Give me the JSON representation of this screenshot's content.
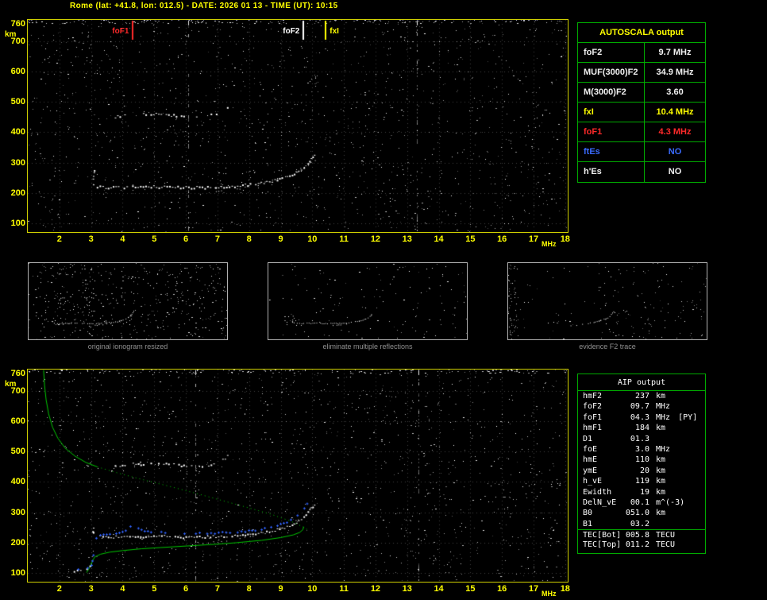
{
  "header": {
    "title": "Rome (lat: +41.8, lon: 012.5) - DATE: 2026 01 13 - TIME (UT): 10:15"
  },
  "autoscala": {
    "title": "AUTOSCALA output",
    "rows": [
      {
        "label": "foF2",
        "value": "9.7 MHz",
        "color": "#f0f0f0"
      },
      {
        "label": "MUF(3000)F2",
        "value": "34.9 MHz",
        "color": "#f0f0f0"
      },
      {
        "label": "M(3000)F2",
        "value": "3.60",
        "color": "#f0f0f0"
      },
      {
        "label": "fxI",
        "value": "10.4 MHz",
        "color": "#ffff00"
      },
      {
        "label": "foF1",
        "value": "4.3 MHz",
        "color": "#ff2a2a"
      },
      {
        "label": "ftEs",
        "value": "NO",
        "color": "#3a6bff"
      },
      {
        "label": "h'Es",
        "value": "NO",
        "color": "#f0f0f0"
      }
    ]
  },
  "aip": {
    "title": "AIP output",
    "rows": [
      {
        "label": "hmF2",
        "value": "237",
        "unit": "km",
        "extra": ""
      },
      {
        "label": "foF2",
        "value": "09.7",
        "unit": "MHz",
        "extra": ""
      },
      {
        "label": "foF1",
        "value": "04.3",
        "unit": "MHz",
        "extra": "[PY]"
      },
      {
        "label": "hmF1",
        "value": "184",
        "unit": "km",
        "extra": ""
      },
      {
        "label": "D1",
        "value": "01.3",
        "unit": "",
        "extra": ""
      },
      {
        "label": "foE",
        "value": "3.0",
        "unit": "MHz",
        "extra": ""
      },
      {
        "label": "hmE",
        "value": "110",
        "unit": "km",
        "extra": ""
      },
      {
        "label": "ymE",
        "value": "20",
        "unit": "km",
        "extra": ""
      },
      {
        "label": "h_vE",
        "value": "119",
        "unit": "km",
        "extra": ""
      },
      {
        "label": "Ewidth",
        "value": "19",
        "unit": "km",
        "extra": ""
      },
      {
        "label": "DelN_vE",
        "value": "00.1",
        "unit": "m^(-3)",
        "extra": ""
      },
      {
        "label": "B0",
        "value": "051.0",
        "unit": "km",
        "extra": ""
      },
      {
        "label": "B1",
        "value": "03.2",
        "unit": "",
        "extra": ""
      },
      {
        "label": "TEC[Bot]",
        "value": "005.8",
        "unit": "TECU",
        "extra": "",
        "sep": true
      },
      {
        "label": "TEC[Top]",
        "value": "011.2",
        "unit": "TECU",
        "extra": ""
      }
    ]
  },
  "thumbs": [
    {
      "caption": "original ionogram resized"
    },
    {
      "caption": "eliminate multiple reflections"
    },
    {
      "caption": "evidence F2 trace"
    }
  ],
  "chart_data": [
    {
      "id": "main_ionogram",
      "type": "scatter",
      "title": "vertical incidence ionogram",
      "xlabel": "MHz",
      "ylabel": "km",
      "xlim": [
        1,
        18.08
      ],
      "ylim": [
        70,
        772
      ],
      "xticks": [
        2,
        3,
        4,
        5,
        6,
        7,
        8,
        9,
        10,
        11,
        12,
        13,
        14,
        15,
        16,
        17,
        18
      ],
      "yticks": [
        760,
        700,
        600,
        500,
        400,
        300,
        200,
        100
      ],
      "grid": true,
      "markers": [
        {
          "label": "foF1",
          "x": 4.3,
          "color": "#ff2a2a",
          "side": "left"
        },
        {
          "label": "foF2",
          "x": 9.7,
          "color": "#ffffff",
          "side": "left"
        },
        {
          "label": "fxI",
          "x": 10.4,
          "color": "#ffff00",
          "side": "right"
        }
      ],
      "streaks": [
        6.08,
        13.3
      ],
      "noise": {
        "seed": 7,
        "count": 1400
      },
      "series": [
        {
          "name": "foE-spread",
          "style": "dots",
          "color": "#ffffff",
          "density": 0.55,
          "size": 2,
          "points": [
            [
              3.04,
              235
            ],
            [
              3.06,
              252
            ],
            [
              3.08,
              270
            ],
            [
              3.1,
              287
            ],
            [
              3.12,
              302
            ]
          ]
        },
        {
          "name": "f-trace-flat",
          "style": "dots",
          "color": "#ffffff",
          "density": 0.95,
          "size": 2,
          "points": [
            [
              3.06,
              231
            ],
            [
              3.18,
              223
            ],
            [
              3.45,
              219
            ],
            [
              3.85,
              219
            ],
            [
              4.3,
              221
            ],
            [
              4.8,
              222
            ],
            [
              5.3,
              221
            ],
            [
              5.9,
              219
            ],
            [
              6.5,
              219
            ],
            [
              7.1,
              221
            ],
            [
              7.7,
              225
            ],
            [
              8.1,
              229
            ],
            [
              8.45,
              234
            ]
          ]
        },
        {
          "name": "f-trace-rise",
          "style": "dots",
          "color": "#ffffff",
          "density": 0.92,
          "size": 2,
          "points": [
            [
              8.45,
              234
            ],
            [
              8.8,
              241
            ],
            [
              9.1,
              250
            ],
            [
              9.35,
              260
            ],
            [
              9.55,
              272
            ],
            [
              9.72,
              286
            ],
            [
              9.85,
              301
            ],
            [
              9.95,
              315
            ],
            [
              10.05,
              328
            ],
            [
              10.13,
              338
            ]
          ]
        },
        {
          "name": "x-trace",
          "style": "dots",
          "color": "#ffffff",
          "density": 0.5,
          "size": 1,
          "points": [
            [
              6.2,
              196
            ],
            [
              6.7,
              201
            ],
            [
              7.2,
              208
            ],
            [
              7.7,
              216
            ],
            [
              8.2,
              226
            ],
            [
              8.65,
              238
            ],
            [
              9.05,
              252
            ],
            [
              9.4,
              266
            ],
            [
              9.7,
              282
            ],
            [
              9.95,
              299
            ],
            [
              10.15,
              317
            ],
            [
              10.28,
              331
            ]
          ]
        },
        {
          "name": "second-hop",
          "style": "dots",
          "color": "#ffffff",
          "density": 0.45,
          "size": 2,
          "points": [
            [
              3.75,
              452
            ],
            [
              4.05,
              457
            ],
            [
              4.4,
              461
            ],
            [
              4.8,
              462
            ],
            [
              5.2,
              461
            ],
            [
              5.6,
              458
            ],
            [
              6.0,
              455
            ],
            [
              6.4,
              454
            ],
            [
              6.7,
              457
            ],
            [
              6.95,
              464
            ],
            [
              7.15,
              474
            ],
            [
              7.3,
              487
            ],
            [
              7.42,
              501
            ]
          ]
        }
      ]
    },
    {
      "id": "profile_ionogram",
      "type": "scatter",
      "title": "ionogram with restored trace and electron density profile",
      "xlabel": "MHz",
      "ylabel": "km",
      "xlim": [
        1,
        18.08
      ],
      "ylim": [
        70,
        772
      ],
      "xticks": [
        2,
        3,
        4,
        5,
        6,
        7,
        8,
        9,
        10,
        11,
        12,
        13,
        14,
        15,
        16,
        17,
        18
      ],
      "yticks": [
        760,
        700,
        600,
        500,
        400,
        300,
        200,
        100
      ],
      "grid": true,
      "markers": [],
      "streaks": [
        6.3,
        13.35
      ],
      "noise": {
        "seed": 13,
        "count": 1400
      },
      "series_from": "main_ionogram",
      "series_names": [
        "foE-spread",
        "f-trace-flat",
        "f-trace-rise",
        "x-trace",
        "second-hop"
      ],
      "series": [
        {
          "name": "profile-topside",
          "style": "line",
          "color": "#00c800",
          "points": [
            [
              1.5,
              770
            ],
            [
              1.53,
              720
            ],
            [
              1.58,
              672
            ],
            [
              1.66,
              625
            ],
            [
              1.78,
              582
            ],
            [
              1.95,
              545
            ],
            [
              2.18,
              512
            ],
            [
              2.5,
              485
            ],
            [
              2.85,
              464
            ],
            [
              3.2,
              450
            ]
          ]
        },
        {
          "name": "profile-topside-extrap",
          "style": "dashline",
          "color": "#00c800",
          "points": [
            [
              3.2,
              450
            ],
            [
              3.9,
              428
            ],
            [
              4.7,
              406
            ],
            [
              5.5,
              385
            ],
            [
              6.3,
              363
            ],
            [
              7.1,
              340
            ],
            [
              7.9,
              317
            ],
            [
              8.7,
              293
            ],
            [
              9.3,
              271
            ],
            [
              9.7,
              252
            ],
            [
              9.85,
              242
            ]
          ]
        },
        {
          "name": "profile-bottomside",
          "style": "line",
          "color": "#00c800",
          "points": [
            [
              2.86,
              100
            ],
            [
              2.9,
              107
            ],
            [
              2.95,
              116
            ],
            [
              3.0,
              127
            ],
            [
              3.05,
              140
            ],
            [
              3.12,
              152
            ],
            [
              3.3,
              161
            ],
            [
              3.6,
              168
            ],
            [
              4.0,
              173
            ],
            [
              4.6,
              179
            ],
            [
              5.2,
              183
            ],
            [
              6.0,
              188
            ],
            [
              6.8,
              193
            ],
            [
              7.6,
              199
            ],
            [
              8.4,
              207
            ],
            [
              9.0,
              216
            ],
            [
              9.4,
              225
            ],
            [
              9.6,
              233
            ],
            [
              9.7,
              242
            ],
            [
              9.73,
              252
            ]
          ]
        },
        {
          "name": "e-echo",
          "style": "dots",
          "color": "#ffffff",
          "density": 0.9,
          "size": 2,
          "points": [
            [
              2.35,
              103
            ],
            [
              2.55,
              108
            ],
            [
              2.75,
              114
            ],
            [
              2.95,
              121
            ],
            [
              3.05,
              128
            ]
          ]
        },
        {
          "name": "restored-e-trace",
          "style": "cross",
          "color": "#3264ff",
          "points": [
            [
              2.6,
              112
            ],
            [
              2.75,
              114
            ],
            [
              2.9,
              117
            ],
            [
              3.0,
              120
            ]
          ]
        },
        {
          "name": "restored-trace",
          "style": "cross",
          "color": "#3264ff",
          "points": [
            [
              3.02,
              122
            ],
            [
              3.05,
              140
            ],
            [
              3.08,
              160
            ],
            [
              3.1,
              180
            ],
            [
              3.13,
              200
            ],
            [
              3.17,
              215
            ],
            [
              3.3,
              222
            ],
            [
              3.6,
              227
            ],
            [
              3.9,
              233
            ],
            [
              4.1,
              241
            ],
            [
              4.25,
              252
            ],
            [
              4.35,
              262
            ],
            [
              4.5,
              248
            ],
            [
              4.7,
              238
            ],
            [
              5.1,
              233
            ],
            [
              5.6,
              230
            ],
            [
              6.2,
              229
            ],
            [
              6.8,
              230
            ],
            [
              7.4,
              233
            ],
            [
              8.0,
              238
            ],
            [
              8.5,
              246
            ],
            [
              8.9,
              256
            ],
            [
              9.2,
              267
            ],
            [
              9.45,
              280
            ],
            [
              9.62,
              294
            ],
            [
              9.75,
              310
            ],
            [
              9.84,
              326
            ],
            [
              9.9,
              340
            ]
          ]
        }
      ]
    },
    {
      "id": "thumb_original",
      "type": "thumb",
      "xlim": [
        1,
        18.08
      ],
      "ylim": [
        70,
        772
      ],
      "noise": {
        "seed": 3,
        "count": 500
      },
      "series_from": "main_ionogram",
      "series_names": [
        "foE-spread",
        "f-trace-flat",
        "f-trace-rise",
        "x-trace",
        "second-hop"
      ]
    },
    {
      "id": "thumb_cleaned",
      "type": "thumb",
      "xlim": [
        1,
        18.08
      ],
      "ylim": [
        70,
        772
      ],
      "noise": {
        "seed": 4,
        "count": 150
      },
      "series_from": "main_ionogram",
      "series_names": [
        "foE-spread",
        "f-trace-flat",
        "f-trace-rise",
        "x-trace"
      ]
    },
    {
      "id": "thumb_f2",
      "type": "thumb",
      "xlim": [
        1,
        18.08
      ],
      "ylim": [
        70,
        772
      ],
      "noise": {
        "seed": 5,
        "count": 60
      },
      "noise_regions": [
        {
          "x0": 0.0,
          "x1": 0.05,
          "count": 55
        },
        {
          "x0": 0.45,
          "x1": 1.0,
          "count": 110
        }
      ],
      "series_from": "main_ionogram",
      "series_names": [
        "f-trace-rise",
        "x-trace"
      ]
    }
  ]
}
